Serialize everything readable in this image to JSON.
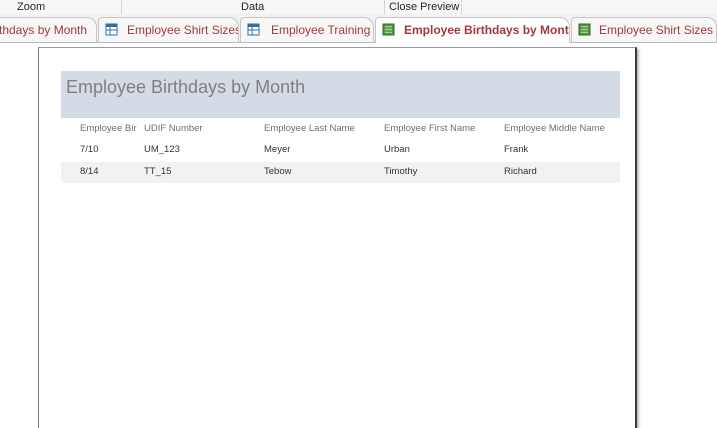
{
  "ribbon": {
    "groups": [
      "Zoom",
      "Data",
      "Close Preview"
    ]
  },
  "tabs": [
    {
      "label": "thdays by Month",
      "icon": "report-icon",
      "active": false
    },
    {
      "label": "Employee Shirt Sizes",
      "icon": "query-icon",
      "active": false
    },
    {
      "label": "Employee Training",
      "icon": "query-icon",
      "active": false
    },
    {
      "label": "Employee Birthdays by Month",
      "icon": "report-icon",
      "active": true
    },
    {
      "label": "Employee Shirt Sizes",
      "icon": "report-icon",
      "active": false
    }
  ],
  "report": {
    "title": "Employee Birthdays by Month",
    "columns": [
      "Employee Bir",
      "UDIF Number",
      "Employee Last Name",
      "Employee First Name",
      "Employee Middle Name"
    ],
    "rows": [
      [
        "7/10",
        "UM_123",
        "Meyer",
        "Urban",
        "Frank"
      ],
      [
        "8/14",
        "TT_15",
        "Tebow",
        "Timothy",
        "Richard"
      ]
    ]
  },
  "colors": {
    "tab_text": "#a4373a",
    "title_band": "#d5dbe4",
    "alt_row": "#f2f2f2"
  }
}
